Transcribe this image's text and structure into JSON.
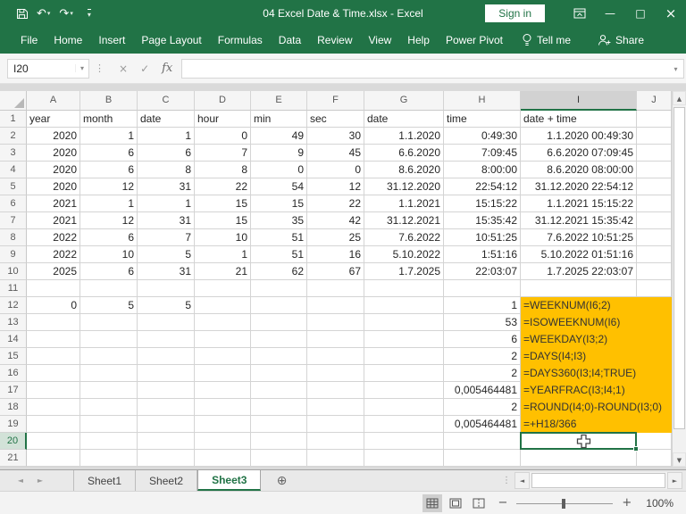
{
  "window": {
    "title": "04 Excel Date & Time.xlsx  -  Excel",
    "sign_in_label": "Sign in"
  },
  "quick_access": {
    "save_icon": "floppy-disk",
    "undo_icon": "↶",
    "redo_icon": "↷",
    "dropdown_caret": "▾",
    "customize_caret": "▾"
  },
  "window_controls": {
    "minimize": "—",
    "maximize": "□",
    "close": "×"
  },
  "ribbon": {
    "tabs": [
      "File",
      "Home",
      "Insert",
      "Page Layout",
      "Formulas",
      "Data",
      "Review",
      "View",
      "Help",
      "Power Pivot"
    ],
    "tell_me_label": "Tell me",
    "share_label": "Share"
  },
  "formula_bar": {
    "name_box_value": "I20",
    "name_box_caret": "▾",
    "separator_dots": "⋮",
    "cancel_icon": "×",
    "enter_icon": "✓",
    "fx_label": "fx",
    "formula_value": "",
    "expand_caret": "▾"
  },
  "grid": {
    "column_headers": [
      "A",
      "B",
      "C",
      "D",
      "E",
      "F",
      "G",
      "H",
      "I",
      "J"
    ],
    "selected_cell": "I20",
    "selected_column": "I",
    "selected_row": 20,
    "highlight": {
      "row_start": 12,
      "row_end": 19,
      "columns": [
        "I",
        "J"
      ]
    },
    "rows": [
      {
        "n": 1,
        "cells": {
          "A": "year",
          "B": "month",
          "C": "date",
          "D": "hour",
          "E": "min",
          "F": "sec",
          "G": "date",
          "H": "time",
          "I": "date + time"
        }
      },
      {
        "n": 2,
        "cells": {
          "A": "2020",
          "B": "1",
          "C": "1",
          "D": "0",
          "E": "49",
          "F": "30",
          "G": "1.1.2020",
          "H": "0:49:30",
          "I": "1.1.2020 00:49:30"
        }
      },
      {
        "n": 3,
        "cells": {
          "A": "2020",
          "B": "6",
          "C": "6",
          "D": "7",
          "E": "9",
          "F": "45",
          "G": "6.6.2020",
          "H": "7:09:45",
          "I": "6.6.2020 07:09:45"
        }
      },
      {
        "n": 4,
        "cells": {
          "A": "2020",
          "B": "6",
          "C": "8",
          "D": "8",
          "E": "0",
          "F": "0",
          "G": "8.6.2020",
          "H": "8:00:00",
          "I": "8.6.2020 08:00:00"
        }
      },
      {
        "n": 5,
        "cells": {
          "A": "2020",
          "B": "12",
          "C": "31",
          "D": "22",
          "E": "54",
          "F": "12",
          "G": "31.12.2020",
          "H": "22:54:12",
          "I": "31.12.2020 22:54:12"
        }
      },
      {
        "n": 6,
        "cells": {
          "A": "2021",
          "B": "1",
          "C": "1",
          "D": "15",
          "E": "15",
          "F": "22",
          "G": "1.1.2021",
          "H": "15:15:22",
          "I": "1.1.2021 15:15:22"
        }
      },
      {
        "n": 7,
        "cells": {
          "A": "2021",
          "B": "12",
          "C": "31",
          "D": "15",
          "E": "35",
          "F": "42",
          "G": "31.12.2021",
          "H": "15:35:42",
          "I": "31.12.2021 15:35:42"
        }
      },
      {
        "n": 8,
        "cells": {
          "A": "2022",
          "B": "6",
          "C": "7",
          "D": "10",
          "E": "51",
          "F": "25",
          "G": "7.6.2022",
          "H": "10:51:25",
          "I": "7.6.2022 10:51:25"
        }
      },
      {
        "n": 9,
        "cells": {
          "A": "2022",
          "B": "10",
          "C": "5",
          "D": "1",
          "E": "51",
          "F": "16",
          "G": "5.10.2022",
          "H": "1:51:16",
          "I": "5.10.2022 01:51:16"
        }
      },
      {
        "n": 10,
        "cells": {
          "A": "2025",
          "B": "6",
          "C": "31",
          "D": "21",
          "E": "62",
          "F": "67",
          "G": "1.7.2025",
          "H": "22:03:07",
          "I": "1.7.2025 22:03:07"
        }
      },
      {
        "n": 11,
        "cells": {}
      },
      {
        "n": 12,
        "cells": {
          "A": "0",
          "B": "5",
          "C": "5",
          "H": "1",
          "I": "=WEEKNUM(I6;2)"
        }
      },
      {
        "n": 13,
        "cells": {
          "H": "53",
          "I": "=ISOWEEKNUM(I6)"
        }
      },
      {
        "n": 14,
        "cells": {
          "H": "6",
          "I": "=WEEKDAY(I3;2)"
        }
      },
      {
        "n": 15,
        "cells": {
          "H": "2",
          "I": "=DAYS(I4;I3)"
        }
      },
      {
        "n": 16,
        "cells": {
          "H": "2",
          "I": "=DAYS360(I3;I4;TRUE)"
        }
      },
      {
        "n": 17,
        "cells": {
          "H": "0,005464481",
          "I": "=YEARFRAC(I3;I4;1)"
        }
      },
      {
        "n": 18,
        "cells": {
          "H": "2",
          "I": "=ROUND(I4;0)-ROUND(I3;0)"
        }
      },
      {
        "n": 19,
        "cells": {
          "H": "0,005464481",
          "I": "=+H18/366"
        }
      },
      {
        "n": 20,
        "cells": {}
      },
      {
        "n": 21,
        "cells": {}
      }
    ]
  },
  "sheet_bar": {
    "nav_left_icon": "◄",
    "nav_right_icon": "►",
    "tabs": [
      {
        "label": "Sheet1",
        "active": false
      },
      {
        "label": "Sheet2",
        "active": false
      },
      {
        "label": "Sheet3",
        "active": true
      }
    ],
    "add_sheet_icon": "⊕",
    "resize_dots": "⋮"
  },
  "scrollbars": {
    "up": "▲",
    "down": "▼",
    "left": "◄",
    "right": "►"
  },
  "status_bar": {
    "zoom_out": "−",
    "zoom_in": "+",
    "zoom_level": "100%"
  },
  "colors": {
    "excel_green": "#217346",
    "highlight_orange": "#FFC000",
    "selection_green": "#217346"
  }
}
